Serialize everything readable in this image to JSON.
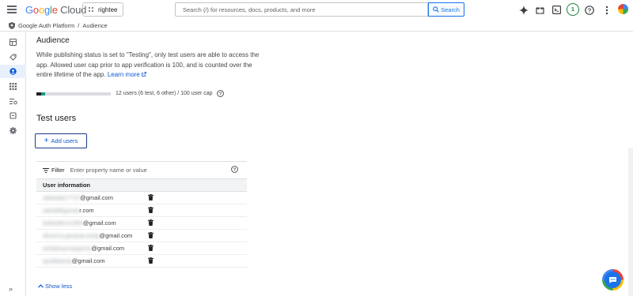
{
  "header": {
    "logo_google": "Google",
    "logo_cloud": "Cloud",
    "project_name": "rightee",
    "search_placeholder": "Search (/) for resources, docs, products, and more",
    "search_button": "Search",
    "trial_badge": "1"
  },
  "breadcrumb": {
    "product": "Google Auth Platform",
    "separator": "/",
    "page": "Audience"
  },
  "main": {
    "audience_heading": "Audience",
    "description": "While publishing status is set to \"Testing\", only test users are able to access the app. Allowed user cap prior to app verification is 100, and is counted over the entire lifetime of the app.",
    "learn_more": "Learn more",
    "user_cap_text": "12 users (6 test, 6 other) / 100 user cap",
    "user_cap": {
      "test": 6,
      "other": 6,
      "cap": 100
    },
    "test_users_heading": "Test users",
    "add_users_label": "Add users",
    "filter_label": "Filter",
    "filter_placeholder": "Enter property name or value",
    "column_header": "User information",
    "users": [
      {
        "blurred": "alakadan7715",
        "visible": "gmail.com",
        "sep": "@"
      },
      {
        "blurred": "aakdalkgavep",
        "visible": "r.com",
        "sep": ""
      },
      {
        "blurred": "balkadkne1969",
        "visible": "gmail.com",
        "sep": "@"
      },
      {
        "blurred": "dhearny.gaupay.aa0g",
        "visible": "gmail.com",
        "sep": "@"
      },
      {
        "blurred": "aolopkaanopppnia",
        "visible": "gmail.com",
        "sep": "@"
      },
      {
        "blurred": "qoaldaaniq",
        "visible": "gmail.com",
        "sep": "@"
      }
    ],
    "show_less": "Show less"
  },
  "colors": {
    "accent": "#0b57d0",
    "active_rail": "#e8f0fe",
    "cap_bar_test": "#202124",
    "cap_bar_other": "#1a9a8a"
  },
  "icons": {
    "rail": [
      "dashboard-icon",
      "branding-icon",
      "audience-icon",
      "clients-icon",
      "data-access-icon",
      "verification-icon",
      "settings-icon"
    ],
    "topbar": [
      "gemini-icon",
      "gift-icon",
      "cloud-shell-icon",
      "help-icon",
      "more-vert-icon"
    ]
  }
}
